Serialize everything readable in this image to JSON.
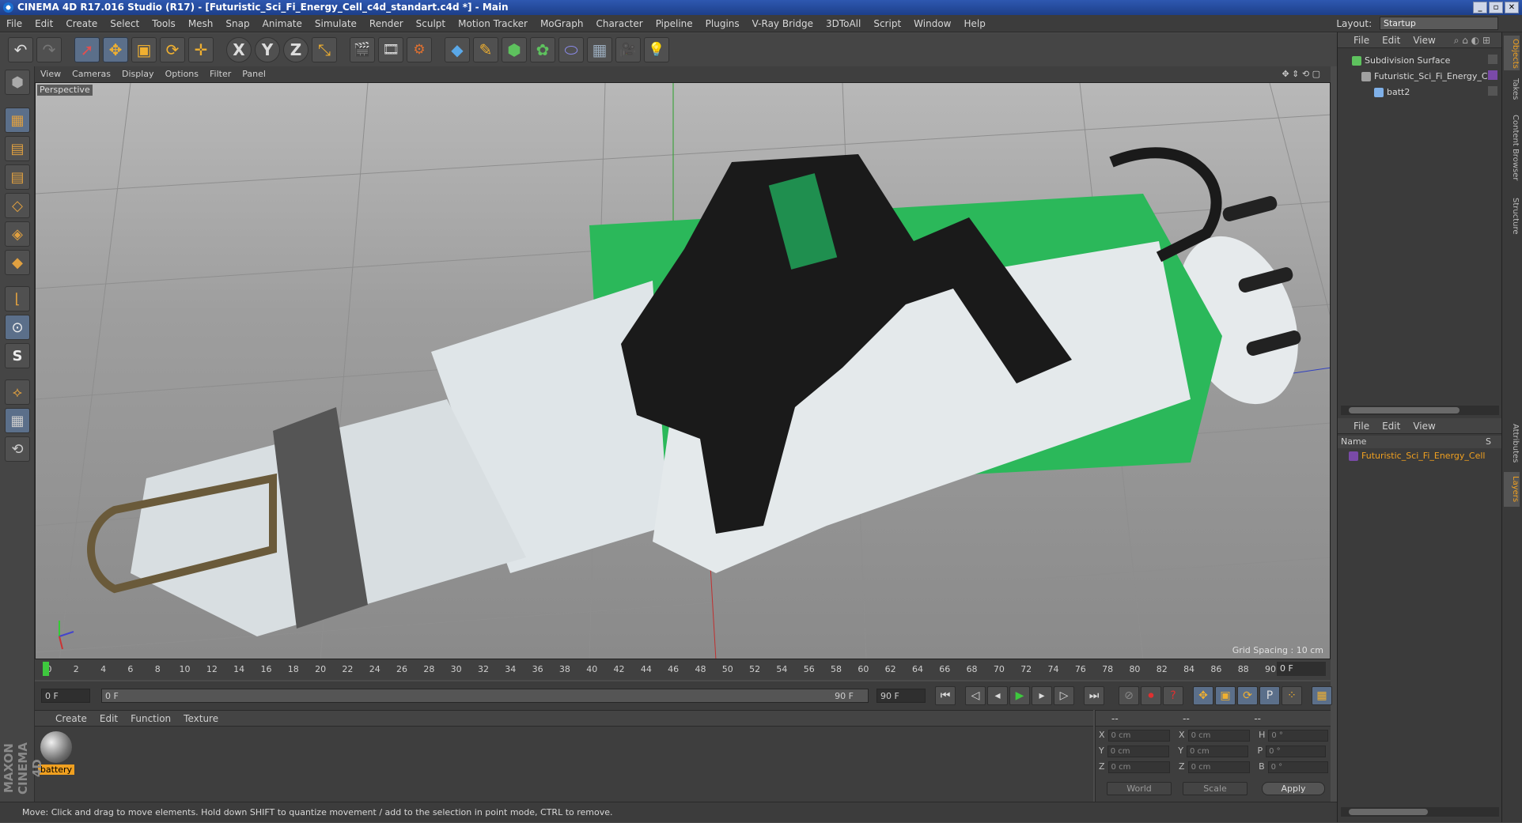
{
  "title": "CINEMA 4D R17.016 Studio (R17) - [Futuristic_Sci_Fi_Energy_Cell_c4d_standart.c4d *] - Main",
  "window_buttons": [
    "_",
    "▫",
    "✕"
  ],
  "menu": [
    "File",
    "Edit",
    "Create",
    "Select",
    "Tools",
    "Mesh",
    "Snap",
    "Animate",
    "Simulate",
    "Render",
    "Sculpt",
    "Motion Tracker",
    "MoGraph",
    "Character",
    "Pipeline",
    "Plugins",
    "V-Ray Bridge",
    "3DToAll",
    "Script",
    "Window",
    "Help"
  ],
  "layout": {
    "label": "Layout:",
    "value": "Startup"
  },
  "toolbar": {
    "undo": "↶",
    "redo": "↷",
    "live_select": "➚",
    "move": "✥",
    "scale": "▣",
    "rotate": "⟳",
    "recent": "✛",
    "x": "X",
    "y": "Y",
    "z": "Z",
    "coord": "⤡",
    "render_view": "🎬",
    "render_pv": "🎞",
    "render_settings": "⚙",
    "cube": "◆",
    "pen": "✎",
    "subdiv": "⬢",
    "array": "✿",
    "deformer": "⬭",
    "floor": "▦",
    "camera": "🎥",
    "light": "💡"
  },
  "left_tools": [
    "⬢",
    "▦",
    "▤",
    "◇",
    "◈",
    "◆",
    "⌊",
    "⊙",
    "S",
    "⟡",
    "▦",
    "⟲"
  ],
  "viewport": {
    "menu": [
      "View",
      "Cameras",
      "Display",
      "Options",
      "Filter",
      "Panel"
    ],
    "label": "Perspective",
    "grid_spacing": "Grid Spacing : 10 cm",
    "nav_icons": "✥ ⇕ ⟲ ▢"
  },
  "timeline": {
    "ticks": [
      "0",
      "2",
      "4",
      "6",
      "8",
      "10",
      "12",
      "14",
      "16",
      "18",
      "20",
      "22",
      "24",
      "26",
      "28",
      "30",
      "32",
      "34",
      "36",
      "38",
      "40",
      "42",
      "44",
      "46",
      "48",
      "50",
      "52",
      "54",
      "56",
      "58",
      "60",
      "62",
      "64",
      "66",
      "68",
      "70",
      "72",
      "74",
      "76",
      "78",
      "80",
      "82",
      "84",
      "86",
      "88",
      "90"
    ],
    "current_frame": "0 F"
  },
  "playback": {
    "start": "0 F",
    "range_start": "0 F",
    "range_end": "90 F",
    "end": "90 F",
    "buttons": [
      "⏮",
      "◁",
      "◂",
      "▶",
      "▸",
      "▷",
      "⏭"
    ],
    "rec_buttons": [
      "⊘",
      "⏺",
      "?"
    ],
    "key_buttons": [
      "✥",
      "▣",
      "⟳",
      "P",
      "⁘",
      "▦"
    ]
  },
  "material_panel": {
    "menu": [
      "Create",
      "Edit",
      "Function",
      "Texture"
    ],
    "materials": [
      {
        "name": "battery"
      }
    ]
  },
  "coords": {
    "headers": [
      "--",
      "--",
      "--"
    ],
    "rows": [
      {
        "a": "X",
        "av": "0 cm",
        "b": "X",
        "bv": "0 cm",
        "c": "H",
        "cv": "0 °"
      },
      {
        "a": "Y",
        "av": "0 cm",
        "b": "Y",
        "bv": "0 cm",
        "c": "P",
        "cv": "0 °"
      },
      {
        "a": "Z",
        "av": "0 cm",
        "b": "Z",
        "bv": "0 cm",
        "c": "B",
        "cv": "0 °"
      }
    ],
    "mode1": "World",
    "mode2": "Scale",
    "apply": "Apply"
  },
  "status": "Move: Click and drag to move elements. Hold down SHIFT to quantize movement / add to the selection in point mode, CTRL to remove.",
  "maxon": "MAXON CINEMA 4D",
  "object_manager": {
    "menu": [
      "File",
      "Edit",
      "View"
    ],
    "objects": [
      {
        "name": "Subdivision Surface",
        "color": "#5ec25e"
      },
      {
        "name": "Futuristic_Sci_Fi_Energy_Cell",
        "color": "#a0a0a0"
      },
      {
        "name": "batt2",
        "color": "#7fb0e8"
      }
    ]
  },
  "layer_manager": {
    "menu": [
      "File",
      "Edit",
      "View"
    ],
    "col_name": "Name",
    "col_s": "S",
    "layers": [
      {
        "name": "Futuristic_Sci_Fi_Energy_Cell",
        "color": "#7a4aa8"
      }
    ]
  },
  "side_tabs": [
    "Objects",
    "Takes",
    "Content Browser",
    "Structure"
  ],
  "side_tabs2": [
    "Attributes",
    "Layers"
  ],
  "accent": "#f0a020"
}
